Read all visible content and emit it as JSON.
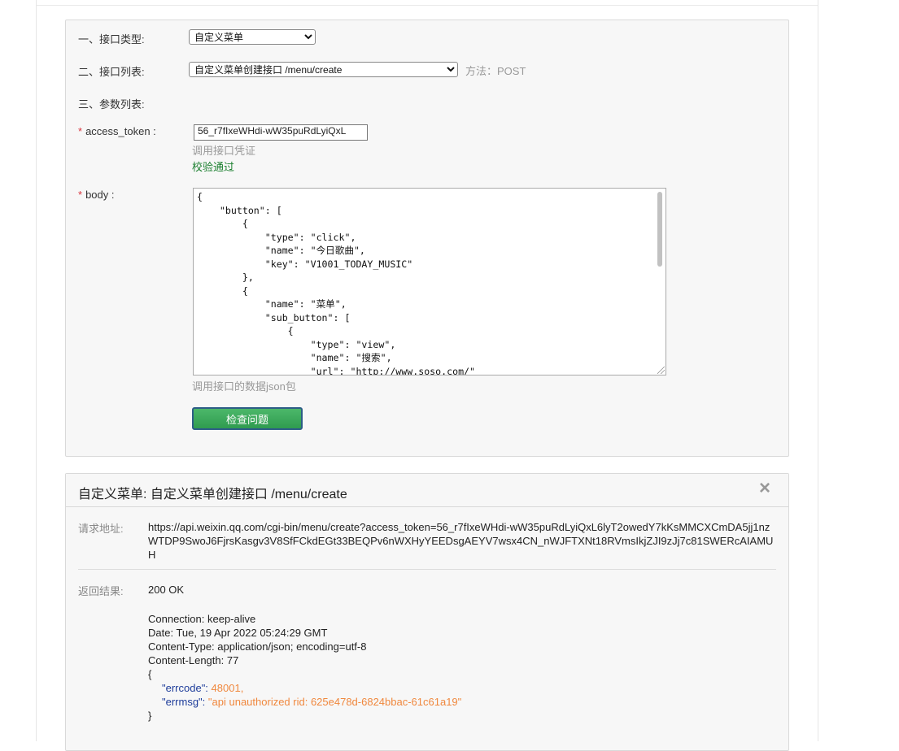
{
  "form": {
    "interface_type_label": "一、接口类型:",
    "interface_type_value": "自定义菜单",
    "interface_list_label": "二、接口列表:",
    "interface_list_value": "自定义菜单创建接口 /menu/create",
    "method_text": "方法：POST",
    "param_list_label": "三、参数列表:",
    "access_token_label": "access_token :",
    "access_token_value": "56_r7fIxeWHdi-wW35puRdLyiQxL",
    "access_token_hint": "调用接口凭证",
    "access_token_status": "校验通过",
    "body_label": "body :",
    "body_hint": "调用接口的数据json包",
    "required_mark": "*",
    "check_button": "检查问题",
    "body_json": "{\n    \"button\": [\n        {\n            \"type\": \"click\",\n            \"name\": \"今日歌曲\",\n            \"key\": \"V1001_TODAY_MUSIC\"\n        },\n        {\n            \"name\": \"菜单\",\n            \"sub_button\": [\n                {\n                    \"type\": \"view\",\n                    \"name\": \"搜索\",\n                    \"url\": \"http://www.soso.com/\"\n                },"
  },
  "result": {
    "title": "自定义菜单: 自定义菜单创建接口 /menu/create",
    "request_url_label": "请求地址:",
    "request_url": "https://api.weixin.qq.com/cgi-bin/menu/create?access_token=56_r7fIxeWHdi-wW35puRdLyiQxL6lyT2owedY7kKsMMCXCmDA5jj1nzWTDP9SwoJ6FjrsKasgv3V8SfFCkdEGt33BEQPv6nWXHyYEEDsgAEYV7wsx4CN_nWJFTXNt18RVmsIkjZJI9zJj7c81SWERcAIAMUH",
    "result_label": "返回结果:",
    "status": "200 OK",
    "headers": [
      "Connection: keep-alive",
      "Date: Tue, 19 Apr 2022 05:24:29 GMT",
      "Content-Type: application/json; encoding=utf-8",
      "Content-Length: 77"
    ],
    "brace_open": "{",
    "brace_close": "}",
    "errcode_key": "\"errcode\":",
    "errcode_value": "48001,",
    "errmsg_key": "\"errmsg\":",
    "errmsg_value": "\"api unauthorized rid: 625e478d-6824bbac-61c61a19\""
  },
  "icons": {
    "close": "close-icon",
    "dropdown": "chevron-down-icon"
  }
}
